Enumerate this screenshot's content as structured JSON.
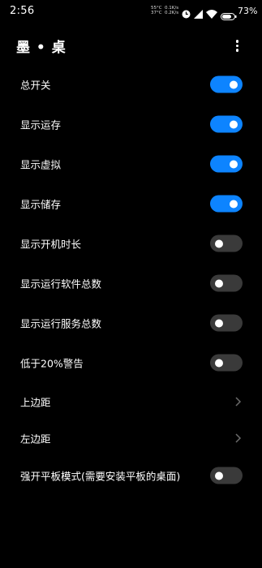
{
  "status_bar": {
    "time": "2:56",
    "temp_1": "55°C",
    "temp_2": "37°C",
    "speed_up": "0.1K/s",
    "speed_down": "0.2K/s",
    "battery": "73%",
    "icons": [
      "alarm-icon",
      "signal-icon",
      "wifi-icon",
      "battery-icon"
    ]
  },
  "header": {
    "title": "墨 • 桌",
    "menu_icon": "more-vertical-icon"
  },
  "settings": [
    {
      "label": "总开关",
      "type": "toggle",
      "on": true
    },
    {
      "label": "显示运存",
      "type": "toggle",
      "on": true
    },
    {
      "label": "显示虚拟",
      "type": "toggle",
      "on": true
    },
    {
      "label": "显示储存",
      "type": "toggle",
      "on": true
    },
    {
      "label": "显示开机时长",
      "type": "toggle",
      "on": false
    },
    {
      "label": "显示运行软件总数",
      "type": "toggle",
      "on": false
    },
    {
      "label": "显示运行服务总数",
      "type": "toggle",
      "on": false
    },
    {
      "label": "低于20%警告",
      "type": "toggle",
      "on": false
    },
    {
      "label": "上边距",
      "type": "link"
    },
    {
      "label": "左边距",
      "type": "link"
    },
    {
      "label": "强开平板模式(需要安装平板的桌面)",
      "type": "toggle",
      "on": false
    }
  ],
  "colors": {
    "background": "#000000",
    "toggle_on": "#0d84ff",
    "toggle_off": "#3a3a3a",
    "text": "#ffffff",
    "chevron": "#6b6b6b"
  }
}
